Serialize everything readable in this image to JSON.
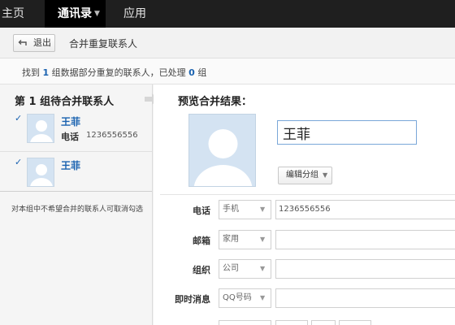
{
  "nav": {
    "home": "主页",
    "contacts": "通讯录",
    "apps": "应用"
  },
  "toolbar": {
    "back_label": "退出",
    "title": "合并重复联系人"
  },
  "info": {
    "prefix": "找到",
    "group_count": "1",
    "middle": "组数据部分重复的联系人，已处理",
    "processed_count": "0",
    "suffix": "组"
  },
  "left": {
    "title": "第 1 组待合并联系人",
    "contacts": [
      {
        "name": "王菲",
        "phone_label": "电话",
        "phone": "1236556556",
        "checked": true
      },
      {
        "name": "王菲",
        "checked": true
      }
    ],
    "hint": "对本组中不希望合并的联系人可取消勾选"
  },
  "preview": {
    "title": "预览合并结果：",
    "name_value": "王菲",
    "group_button": "编辑分组",
    "fields": [
      {
        "label": "电话",
        "type": "手机",
        "value": "1236556556"
      },
      {
        "label": "邮箱",
        "type": "家用",
        "value": ""
      },
      {
        "label": "组织",
        "type": "公司",
        "value": ""
      },
      {
        "label": "即时消息",
        "type": "QQ号码",
        "value": ""
      }
    ]
  },
  "icons": {
    "back": "back-arrow-icon",
    "caret": "chevron-down-icon",
    "arrow": "arrow-right-icon",
    "avatar": "avatar-placeholder-icon",
    "checkbox": "checkbox-checked-icon"
  },
  "colors": {
    "nav_bg": "#1f1f1f",
    "link_blue": "#1a62b0",
    "avatar_bg": "#d4e3f2"
  }
}
